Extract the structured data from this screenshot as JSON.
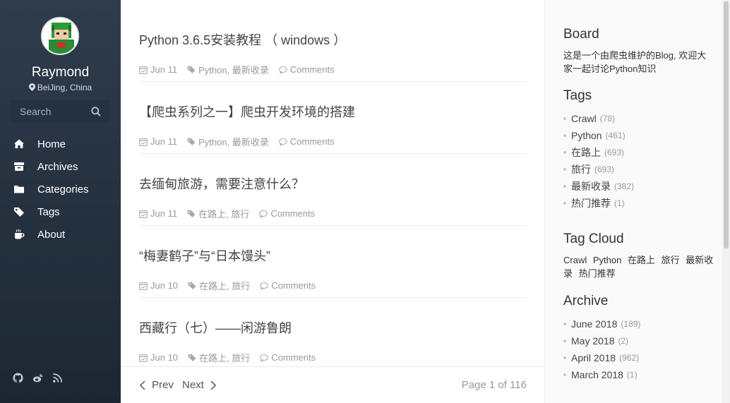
{
  "profile": {
    "name": "Raymond",
    "location": "BeiJing, China"
  },
  "search": {
    "placeholder": "Search"
  },
  "nav": [
    {
      "label": "Home",
      "icon": "home-icon"
    },
    {
      "label": "Archives",
      "icon": "archive-icon"
    },
    {
      "label": "Categories",
      "icon": "folder-icon"
    },
    {
      "label": "Tags",
      "icon": "tag-icon"
    },
    {
      "label": "About",
      "icon": "coffee-icon"
    }
  ],
  "social": [
    "github-icon",
    "weibo-icon",
    "rss-icon"
  ],
  "posts": [
    {
      "title": "Python 3.6.5安装教程 （ windows ）",
      "date": "Jun 11",
      "tags": "Python, 最新收录",
      "comments": "Comments"
    },
    {
      "title": "【爬虫系列之一】爬虫开发环境的搭建",
      "date": "Jun 11",
      "tags": "Python, 最新收录",
      "comments": "Comments"
    },
    {
      "title": "去缅甸旅游，需要注意什么？",
      "date": "Jun 11",
      "tags": "在路上, 旅行",
      "comments": "Comments"
    },
    {
      "title": "“梅妻鹤子”与“日本馒头”",
      "date": "Jun 10",
      "tags": "在路上, 旅行",
      "comments": "Comments"
    },
    {
      "title": "西藏行（七）——闲游鲁朗",
      "date": "Jun 10",
      "tags": "在路上, 旅行",
      "comments": "Comments"
    }
  ],
  "pager": {
    "prev": "Prev",
    "next": "Next",
    "info": "Page 1 of 116"
  },
  "board": {
    "title": "Board",
    "text": "这是一个由爬虫维护的Blog, 欢迎大家一起讨论Python知识"
  },
  "tags": {
    "title": "Tags",
    "items": [
      {
        "name": "Crawl",
        "count": "(78)"
      },
      {
        "name": "Python",
        "count": "(461)"
      },
      {
        "name": "在路上",
        "count": "(693)"
      },
      {
        "name": "旅行",
        "count": "(693)"
      },
      {
        "name": "最新收录",
        "count": "(382)"
      },
      {
        "name": "热门推荐",
        "count": "(1)"
      }
    ]
  },
  "tag_cloud": {
    "title": "Tag Cloud",
    "items": [
      "Crawl",
      "Python",
      "在路上",
      "旅行",
      "最新收录",
      "热门推荐"
    ]
  },
  "archive": {
    "title": "Archive",
    "items": [
      {
        "name": "June 2018",
        "count": "(189)"
      },
      {
        "name": "May 2018",
        "count": "(2)"
      },
      {
        "name": "April 2018",
        "count": "(962)"
      },
      {
        "name": "March 2018",
        "count": "(1)"
      }
    ]
  },
  "colors": {
    "sidebar_top": "#2f3c4c",
    "sidebar_bottom": "#1d2733",
    "meta": "#999999"
  }
}
